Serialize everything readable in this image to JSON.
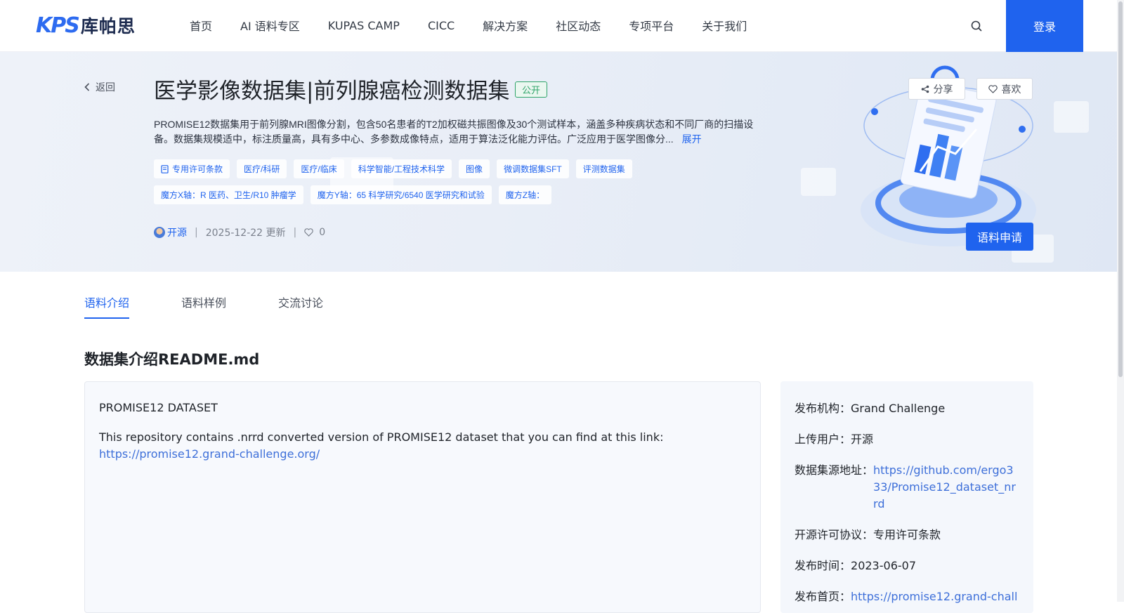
{
  "header": {
    "logo_mark": "KPS",
    "logo_text": "库帕思",
    "nav": [
      "首页",
      "AI 语料专区",
      "KUPAS CAMP",
      "CICC",
      "解决方案",
      "社区动态",
      "专项平台",
      "关于我们"
    ],
    "login_label": "登录"
  },
  "banner": {
    "back_label": "返回",
    "title": "医学影像数据集|前列腺癌检测数据集",
    "visibility_badge": "公开",
    "description": "PROMISE12数据集用于前列腺MRI图像分割，包含50名患者的T2加权磁共振图像及30个测试样本，涵盖多种疾病状态和不同厂商的扫描设备。数据集规模适中，标注质量高，具有多中心、多参数成像特点，适用于算法泛化能力评估。广泛应用于医学图像分...",
    "expand_label": "展开",
    "tags_row1": [
      "专用许可条款",
      "医疗/科研",
      "医疗/临床",
      "科学智能/工程技术科学",
      "图像",
      "微调数据集SFT",
      "评测数据集"
    ],
    "tags_row2": [
      "魔方X轴：R 医药、卫生/R10 肿瘤学",
      "魔方Y轴：65 科学研究/6540 医学研究和试验",
      "魔方Z轴："
    ],
    "uploader": "开源",
    "updated": "2025-12-22 更新",
    "likes": "0",
    "share_label": "分享",
    "like_label": "喜欢",
    "apply_label": "语料申请"
  },
  "tabs": [
    "语料介绍",
    "语料样例",
    "交流讨论"
  ],
  "section_title": "数据集介绍README.md",
  "readme": {
    "heading": "PROMISE12 DATASET",
    "text": "This repository contains .nrrd converted version of PROMISE12 dataset that you can find at this link:",
    "link": "https://promise12.grand-challenge.org/"
  },
  "info": {
    "publisher_key": "发布机构：",
    "publisher": "Grand Challenge",
    "uploader_key": "上传用户：",
    "uploader": "开源",
    "source_key": "数据集源地址：",
    "source": "https://github.com/ergo333/Promise12_dataset_nrrd",
    "license_key": "开源许可协议：",
    "license": "专用许可条款",
    "date_key": "发布时间：",
    "date": "2023-06-07",
    "home_key": "发布首页：",
    "home": "https://promise12.grand-chall"
  },
  "colors": {
    "primary": "#1f63ee",
    "public_badge": "#2fa46a",
    "link": "#3d6fd9"
  }
}
